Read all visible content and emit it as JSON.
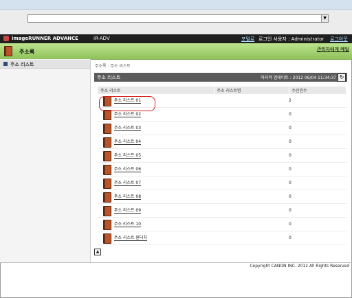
{
  "browser": {
    "url": "",
    "dropdown_icon": "chevron-down-icon"
  },
  "header": {
    "brand": "imageRUNNER ADVANCE",
    "device": "iR-ADV",
    "portal_label": "포털로",
    "login_user_label": "로그인 사용자 : Administrator",
    "logout_label": "로그아웃"
  },
  "page": {
    "title": "주소록",
    "manager_link": "관리자에게 메일"
  },
  "sidebar": {
    "items": [
      {
        "label": "주소 리스트"
      }
    ]
  },
  "breadcrumb": "주소록 : 주소 리스트",
  "panel": {
    "title": "주소 리스트",
    "last_updated": "마지막 업데이트 : 2012 06/04 11:34:37"
  },
  "table": {
    "headers": [
      "주소 리스트",
      "주소 리스트명",
      "수신인수"
    ],
    "rows": [
      {
        "name": "주소 리스트 01",
        "display_name": "",
        "count": "2"
      },
      {
        "name": "주소 리스트 02",
        "display_name": "",
        "count": "0"
      },
      {
        "name": "주소 리스트 03",
        "display_name": "",
        "count": "0"
      },
      {
        "name": "주소 리스트 04",
        "display_name": "",
        "count": "0"
      },
      {
        "name": "주소 리스트 05",
        "display_name": "",
        "count": "0"
      },
      {
        "name": "주소 리스트 06",
        "display_name": "",
        "count": "0"
      },
      {
        "name": "주소 리스트 07",
        "display_name": "",
        "count": "0"
      },
      {
        "name": "주소 리스트 08",
        "display_name": "",
        "count": "0"
      },
      {
        "name": "주소 리스트 09",
        "display_name": "",
        "count": "0"
      },
      {
        "name": "주소 리스트 10",
        "display_name": "",
        "count": "0"
      },
      {
        "name": "주소 리스트 원터치",
        "display_name": "",
        "count": "0"
      }
    ]
  },
  "footer": {
    "copyright": "Copyright CANON INC. 2012 All Rights Reserved"
  }
}
